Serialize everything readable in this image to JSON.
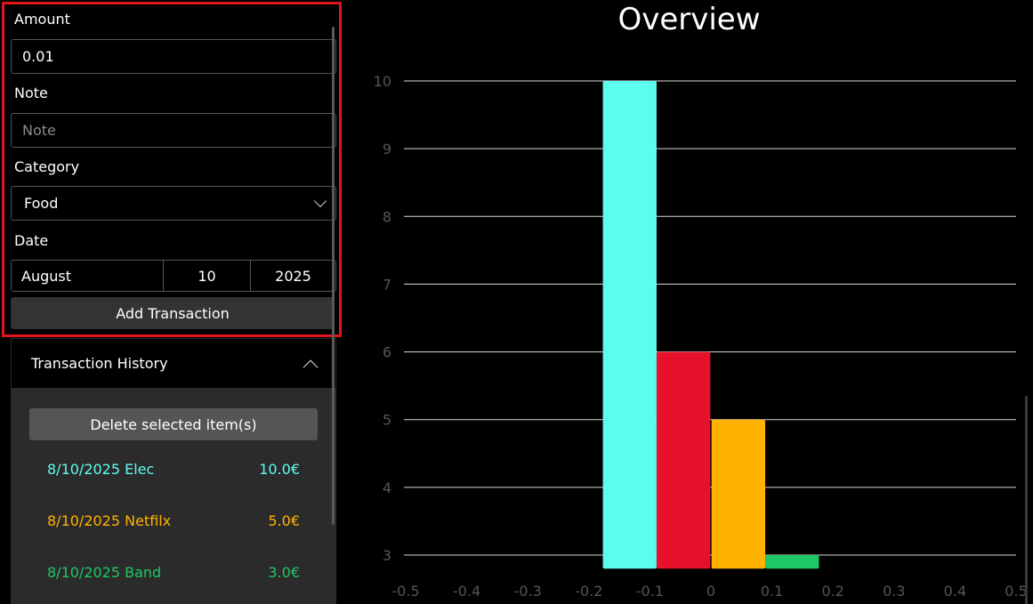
{
  "form": {
    "amount_label": "Amount",
    "amount_value": "0.01",
    "note_label": "Note",
    "note_placeholder": "Note",
    "category_label": "Category",
    "category_value": "Food",
    "date_label": "Date",
    "date_month": "August",
    "date_day": "10",
    "date_year": "2025",
    "add_button": "Add Transaction"
  },
  "history": {
    "title": "Transaction History",
    "delete_button": "Delete selected item(s)",
    "items": [
      {
        "label": "8/10/2025 Elec",
        "amount": "10.0€",
        "color": "#5dfcf0"
      },
      {
        "label": "8/10/2025 Netfilx",
        "amount": "5.0€",
        "color": "#ffb300"
      },
      {
        "label": "8/10/2025 Band",
        "amount": "3.0€",
        "color": "#1ec864"
      }
    ]
  },
  "colors": {
    "accent_border": "#e0161b",
    "grid": "#ffffff"
  },
  "chart_data": {
    "type": "bar",
    "title": "Overview",
    "x_ticks": [
      "-0.5",
      "-0.4",
      "-0.3",
      "-0.2",
      "-0.1",
      "0",
      "0.1",
      "0.2",
      "0.3",
      "0.4",
      "0.5"
    ],
    "y_ticks": [
      "3",
      "4",
      "5",
      "6",
      "7",
      "8",
      "9",
      "10"
    ],
    "xlim": [
      -0.5,
      0.5
    ],
    "ylim": [
      2.8,
      10
    ],
    "grid": "horizontal",
    "bars": [
      {
        "x_center": -0.133,
        "width": 0.088,
        "value": 10,
        "color": "#5dfcf0"
      },
      {
        "x_center": -0.045,
        "width": 0.088,
        "value": 6,
        "color": "#e8112b"
      },
      {
        "x_center": 0.045,
        "width": 0.088,
        "value": 5,
        "color": "#ffb300"
      },
      {
        "x_center": 0.133,
        "width": 0.088,
        "value": 3,
        "color": "#1ec864"
      }
    ]
  }
}
